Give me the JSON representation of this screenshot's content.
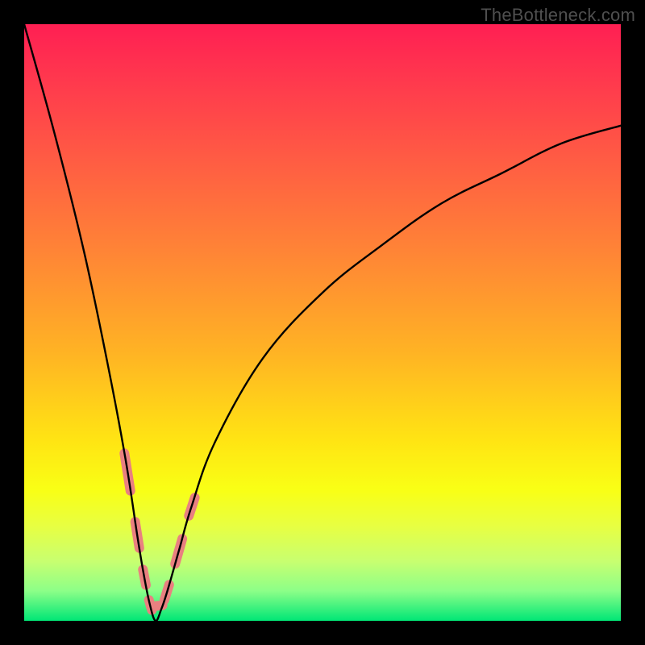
{
  "watermark": "TheBottleneck.com",
  "colors": {
    "gradient_top": "#ff1f53",
    "gradient_mid": "#ffe513",
    "gradient_bottom": "#00e676",
    "curve": "#000000",
    "marker": "#e98080",
    "frame": "#000000"
  },
  "chart_data": {
    "type": "line",
    "title": "",
    "xlabel": "",
    "ylabel": "",
    "xlim": [
      0,
      100
    ],
    "ylim": [
      0,
      100
    ],
    "grid": false,
    "legend": false,
    "notes": "Unlabeled bottleneck curve. Minimum (≈0) occurs around x≈22. Left branch rises steeply toward 100, right branch rises slowly toward ≈83 at x=100. Salmon markers highlight the region near the trough on both branches.",
    "series": [
      {
        "name": "curve",
        "x": [
          0,
          5,
          10,
          14,
          17,
          19,
          20,
          21,
          22,
          23,
          24,
          26,
          28,
          32,
          40,
          50,
          60,
          70,
          80,
          90,
          100
        ],
        "values": [
          100,
          82,
          62,
          43,
          27,
          14,
          8,
          3,
          0,
          2,
          5,
          12,
          19,
          30,
          44,
          55,
          63,
          70,
          75,
          80,
          83
        ]
      }
    ],
    "highlight_x_range": [
      17,
      28
    ]
  }
}
